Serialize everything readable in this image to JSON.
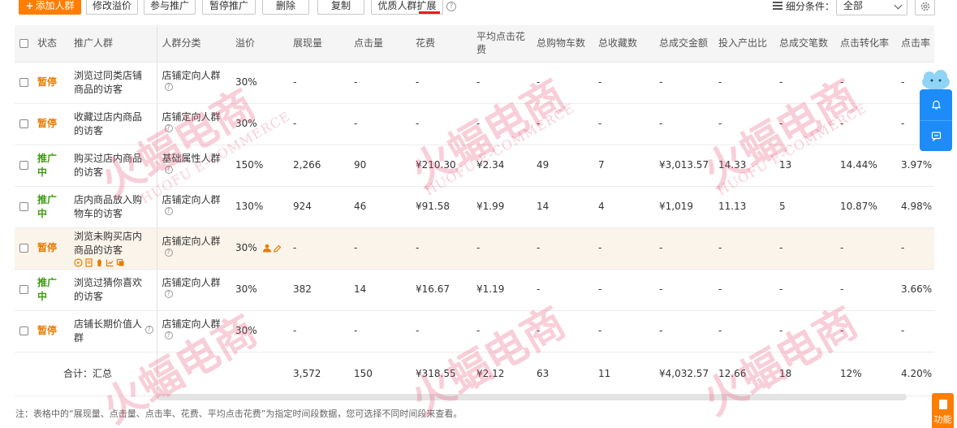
{
  "toolbar": {
    "add_label": "添加人群",
    "modify_premium": "修改溢价",
    "join_promo": "参与推广",
    "pause_promo": "暂停推广",
    "delete": "删除",
    "copy": "复制",
    "quality_expand": "优质人群扩展",
    "filter_label": "细分条件：",
    "filter_value": "全部"
  },
  "columns": {
    "status": "状态",
    "audience": "推广人群",
    "category": "人群分类",
    "premium": "溢价",
    "impressions": "展现量",
    "clicks": "点击量",
    "cost": "花费",
    "avg_cpc": "平均点击花费",
    "cart": "总购物车数",
    "fav": "总收藏数",
    "gmv": "总成交金额",
    "roi": "投入产出比",
    "orders": "总成交笔数",
    "cvr": "点击转化率",
    "ctr": "点击率"
  },
  "rows": [
    {
      "status": "暂停",
      "status_type": "pause",
      "name": "浏览过同类店铺商品的访客",
      "category": "店铺定向人群",
      "premium": "30%",
      "impressions": "-",
      "clicks": "-",
      "cost": "-",
      "avg_cpc": "-",
      "cart": "-",
      "fav": "-",
      "gmv": "-",
      "roi": "-",
      "orders": "-",
      "cvr": "-",
      "ctr": "-"
    },
    {
      "status": "暂停",
      "status_type": "pause",
      "name": "收藏过店内商品的访客",
      "category": "店铺定向人群",
      "premium": "30%",
      "impressions": "-",
      "clicks": "-",
      "cost": "-",
      "avg_cpc": "-",
      "cart": "-",
      "fav": "-",
      "gmv": "-",
      "roi": "-",
      "orders": "-",
      "cvr": "-",
      "ctr": "-"
    },
    {
      "status": "推广中",
      "status_type": "run",
      "name": "购买过店内商品的访客",
      "category": "基础属性人群",
      "premium": "150%",
      "impressions": "2,266",
      "clicks": "90",
      "cost": "¥210.30",
      "avg_cpc": "¥2.34",
      "cart": "49",
      "fav": "7",
      "gmv": "¥3,013.57",
      "roi": "14.33",
      "orders": "13",
      "cvr": "14.44%",
      "ctr": "3.97%"
    },
    {
      "status": "推广中",
      "status_type": "run",
      "name": "店内商品放入购物车的访客",
      "category": "店铺定向人群",
      "premium": "130%",
      "impressions": "924",
      "clicks": "46",
      "cost": "¥91.58",
      "avg_cpc": "¥1.99",
      "cart": "14",
      "fav": "4",
      "gmv": "¥1,019",
      "roi": "11.13",
      "orders": "5",
      "cvr": "10.87%",
      "ctr": "4.98%"
    },
    {
      "status": "暂停",
      "status_type": "pause",
      "name": "浏览未购买店内商品的访客",
      "category": "店铺定向人群",
      "premium": "30%",
      "impressions": "-",
      "clicks": "-",
      "cost": "-",
      "avg_cpc": "-",
      "cart": "-",
      "fav": "-",
      "gmv": "-",
      "roi": "-",
      "orders": "-",
      "cvr": "-",
      "ctr": "-"
    },
    {
      "status": "推广中",
      "status_type": "run",
      "name": "浏览过猜你喜欢的访客",
      "category": "店铺定向人群",
      "premium": "30%",
      "impressions": "382",
      "clicks": "14",
      "cost": "¥16.67",
      "avg_cpc": "¥1.19",
      "cart": "-",
      "fav": "-",
      "gmv": "-",
      "roi": "-",
      "orders": "-",
      "cvr": "-",
      "ctr": "3.66%"
    },
    {
      "status": "暂停",
      "status_type": "pause",
      "name": "店铺长期价值人群",
      "category": "店铺定向人群",
      "premium": "30%",
      "impressions": "-",
      "clicks": "-",
      "cost": "-",
      "avg_cpc": "-",
      "cart": "-",
      "fav": "-",
      "gmv": "-",
      "roi": "-",
      "orders": "-",
      "cvr": "-",
      "ctr": "-"
    }
  ],
  "total": {
    "label": "合计：汇总",
    "impressions": "3,572",
    "clicks": "150",
    "cost": "¥318.55",
    "avg_cpc": "¥2.12",
    "cart": "63",
    "fav": "11",
    "gmv": "¥4,032.57",
    "roi": "12.66",
    "orders": "18",
    "cvr": "12%",
    "ctr": "4.20%"
  },
  "footnote": "注：表格中的“展现量、点击量、点击率、花费、平均点击花费”为指定时间段数据，您可选择不同时间段来查看。",
  "func_tab": "功能",
  "watermark": {
    "main": "火蝠电商",
    "sub": "HUOFU E-COMMERCE"
  },
  "colors": {
    "accent": "#ff7d00",
    "running": "#3d9b12",
    "paused": "#e87b00",
    "fab": "#1d8cf8",
    "highlight_row": "#fbf4ea"
  },
  "icons": [
    "plus-icon",
    "help-icon",
    "list-icon",
    "chevron-down-icon",
    "gear-icon",
    "bell-icon",
    "chat-icon",
    "play-icon",
    "report-icon",
    "trash-icon",
    "chart-icon",
    "copy-icon",
    "person-icon",
    "pencil-icon",
    "document-icon"
  ]
}
